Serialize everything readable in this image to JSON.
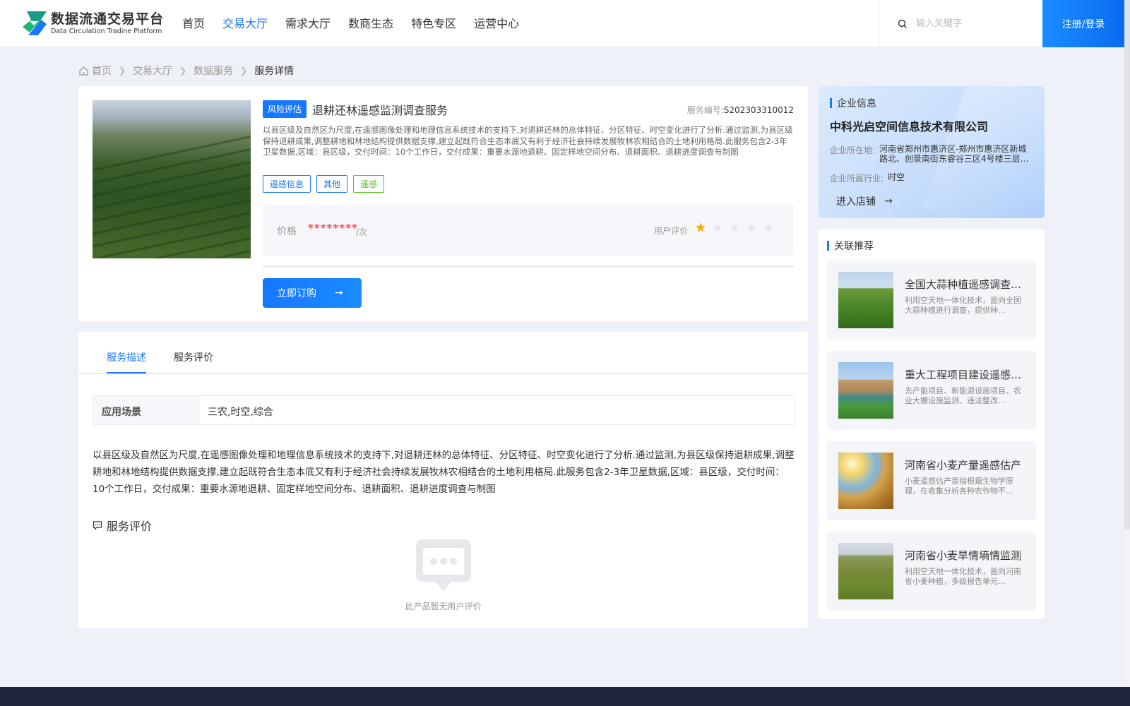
{
  "header": {
    "logo_cn": "数据流通交易平台",
    "logo_en": "Data Circulation Tradine Platform",
    "nav": [
      "首页",
      "交易大厅",
      "需求大厅",
      "数商生态",
      "特色专区",
      "运营中心"
    ],
    "active_nav": 1,
    "search_placeholder": "输入关键字",
    "login_label": "注册/登录"
  },
  "breadcrumb": [
    "首页",
    "交易大厅",
    "数据服务",
    "服务详情"
  ],
  "product": {
    "category_tag": "风险评估",
    "title": "退耕还林遥感监测调查服务",
    "service_no_label": "服务编号:",
    "service_no": "S202303310012",
    "description": "以县区级及自然区为尺度,在遥感图像处理和地理信息系统技术的支持下,对退耕还林的总体特征、分区特征、时空变化进行了分析.通过监测,为县区级保持退耕成果,调整耕地和林地结构提供数据支撑,建立起既符合生态本底又有利于经济社会持续发展牧林农相结合的土地利用格局.此服务包含2-3年卫星数据,区域：县区级，交付时间：10个工作日，交付成果：重要水源地退耕、固定样地空间分布、退耕面积、退耕进度调查与制图",
    "tags": [
      "遥感信息",
      "其他",
      "遥感"
    ],
    "price_label": "价格",
    "price_value": "********",
    "price_unit": "/次",
    "rating_label": "用户评价",
    "rating": 1,
    "rating_max": 5,
    "order_label": "立即订购"
  },
  "tabs": [
    "服务描述",
    "服务评价"
  ],
  "active_tab": 0,
  "scenario": {
    "label": "应用场景",
    "value": "三农,时空,综合"
  },
  "long_description": "以县区级及自然区为尺度,在遥感图像处理和地理信息系统技术的支持下,对退耕还林的总体特征、分区特征、时空变化进行了分析.通过监测,为县区级保持退耕成果,调整耕地和林地结构提供数据支撑,建立起既符合生态本底又有利于经济社会持续发展牧林农相结合的土地利用格局.此服务包含2-3年卫星数据,区域：县区级，交付时间：10个工作日，交付成果：重要水源地退耕、固定样地空间分布、退耕面积、退耕进度调查与制图",
  "reviews": {
    "title": "服务评价",
    "empty_text": "此产品暂无用户评价"
  },
  "company": {
    "section_title": "企业信息",
    "name": "中科光启空间信息技术有限公司",
    "location_label": "企业所在地:",
    "location": "河南省郑州市惠济区-郑州市惠济区新城路北、创景南街东睿谷三区4号楼三层…",
    "industry_label": "企业所属行业:",
    "industry": "时空",
    "enter_label": "进入店铺"
  },
  "recommend": {
    "section_title": "关联推荐",
    "items": [
      {
        "title": "全国大蒜种植遥感调查服务",
        "desc": "利用空天地一体化技术，面向全国大蒜种植进行调查，提供种…"
      },
      {
        "title": "重大工程项目建设遥感监测",
        "desc": "去产能项目、新能源设施项目、农业大棚设施监测、违法整改…"
      },
      {
        "title": "河南省小麦产量遥感估产",
        "desc": "小麦遥感估产是指根据生物学原理，在收集分析各种农作物不…"
      },
      {
        "title": "河南省小麦旱情墒情监测",
        "desc": "利用空天地一体化技术，面向河南省小麦种植，多级报告单元…"
      }
    ]
  },
  "colors": {
    "primary": "#1677ff",
    "price": "#ff4d4f",
    "tag_green": "#52c41a",
    "star_active": "#faad14",
    "star_inactive": "#e8e8e8"
  }
}
